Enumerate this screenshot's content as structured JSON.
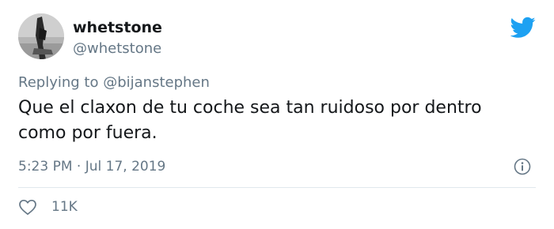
{
  "author": {
    "display_name": "whetstone",
    "handle": "@whetstone"
  },
  "reply": {
    "prefix": "Replying to",
    "mention": "@bijanstephen"
  },
  "tweet": {
    "text_line1": "Que el claxon de tu coche sea tan ruidoso por dentro",
    "text_line2": "como por fuera.",
    "timestamp": "5:23 PM · Jul 17, 2019"
  },
  "actions": {
    "like_count": "11K"
  },
  "icons": {
    "brand": "twitter-bird-icon",
    "info": "info-icon",
    "like": "heart-icon"
  },
  "colors": {
    "brand_blue": "#1da1f2",
    "text_primary": "#14171a",
    "text_secondary": "#657786",
    "divider": "#e1e8ed"
  }
}
